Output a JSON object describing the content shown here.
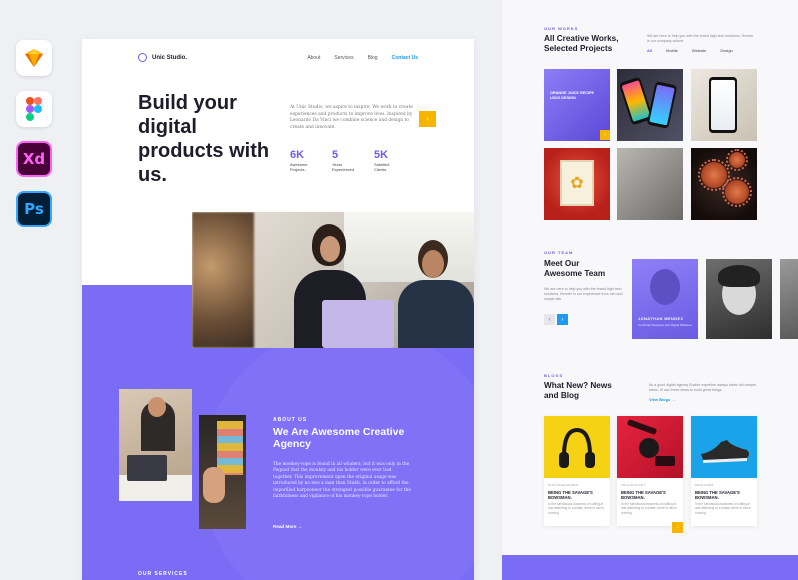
{
  "tools": [
    "Sketch",
    "Figma",
    "Xd",
    "Ps"
  ],
  "brand": {
    "name": "Unic Studio.",
    "accent": "#7b6cf6",
    "highlight": "#f7b500",
    "link": "#1e9bf0"
  },
  "nav": {
    "about": "About",
    "services": "Services",
    "blog": "Blog",
    "contact": "Contact Us"
  },
  "hero": {
    "title": "Build your digital products with us.",
    "text": "At Unic Studio, we aspire to inspire. We work to create experiences and products to improve lives. Inspired by Leonardo Da Vinci we combine science and design to create and innovate.",
    "cta_icon": "arrow-right-icon",
    "cta_glyph": "›",
    "stats": [
      {
        "value": "6K",
        "label": "Awesome Projects."
      },
      {
        "value": "5",
        "label": "Years Experienced"
      },
      {
        "value": "5K",
        "label": "Satisfied Clients."
      }
    ]
  },
  "about": {
    "kicker": "ABOUT US",
    "title": "We Are Awesome Creative Agency",
    "text": "The monkey-rope is found in all whalers; but it was only in the Pequod that the monkey and his holder were ever tied together. This improvement upon the original usage was introduced by no less a man than Stubb, in order to afford the imperilled harpooneer the strongest possible guarantee for the faithfulness and vigilance of his monkey-rope holder.",
    "link": "Read More →"
  },
  "services": {
    "kicker": "OUR SERVICES"
  },
  "works": {
    "kicker": "OUR WORKS",
    "title": "All Creative Works, Selected Projects",
    "text": "We are here to help you with the brand high tech solutions, Render in our company culture.",
    "filters": [
      "All",
      "Mobile",
      "Website",
      "Design"
    ],
    "card1_text": "ORANGE JUICE RECIPE UI/UX DESIGN",
    "card1_glyph": "›"
  },
  "team": {
    "kicker": "OUR TEAM",
    "title": "Meet Our Awesome Team",
    "text": "We are here to help you with the brand high tech solutions, Render in our experience from rich and simple talk.",
    "member_name": "JONATHAN MENDEZ",
    "member_role": "Co-Finder Designer and Digital Marketer",
    "prev_glyph": "‹",
    "next_glyph": "›"
  },
  "blogs": {
    "kicker": "BLOGS",
    "title": "What New? News and Blog",
    "text": "As a good digital agency Enable expertise always starts rich simple ideas, I'll use these ideas to build great things.",
    "view_link": "View Blogs →",
    "more_glyph": "›",
    "posts": [
      {
        "category": "PHOTOGRAPHER",
        "title": "BEING THE SAVAGE'S BOWSMAN.",
        "text": "In the tumultuous business of cutting-in and attending to a whale, there is much running."
      },
      {
        "category": "TECHNOLOGY",
        "title": "BEING THE SAVAGE'S BOWSMAN.",
        "text": "In the tumultuous business of cutting-in and attending to a whale, there is much running."
      },
      {
        "category": "DESIGNER",
        "title": "BEING THE SAVAGE'S BOWSMAN.",
        "text": "In the tumultuous business of cutting-in and attending to a whale, there is much running."
      }
    ]
  }
}
